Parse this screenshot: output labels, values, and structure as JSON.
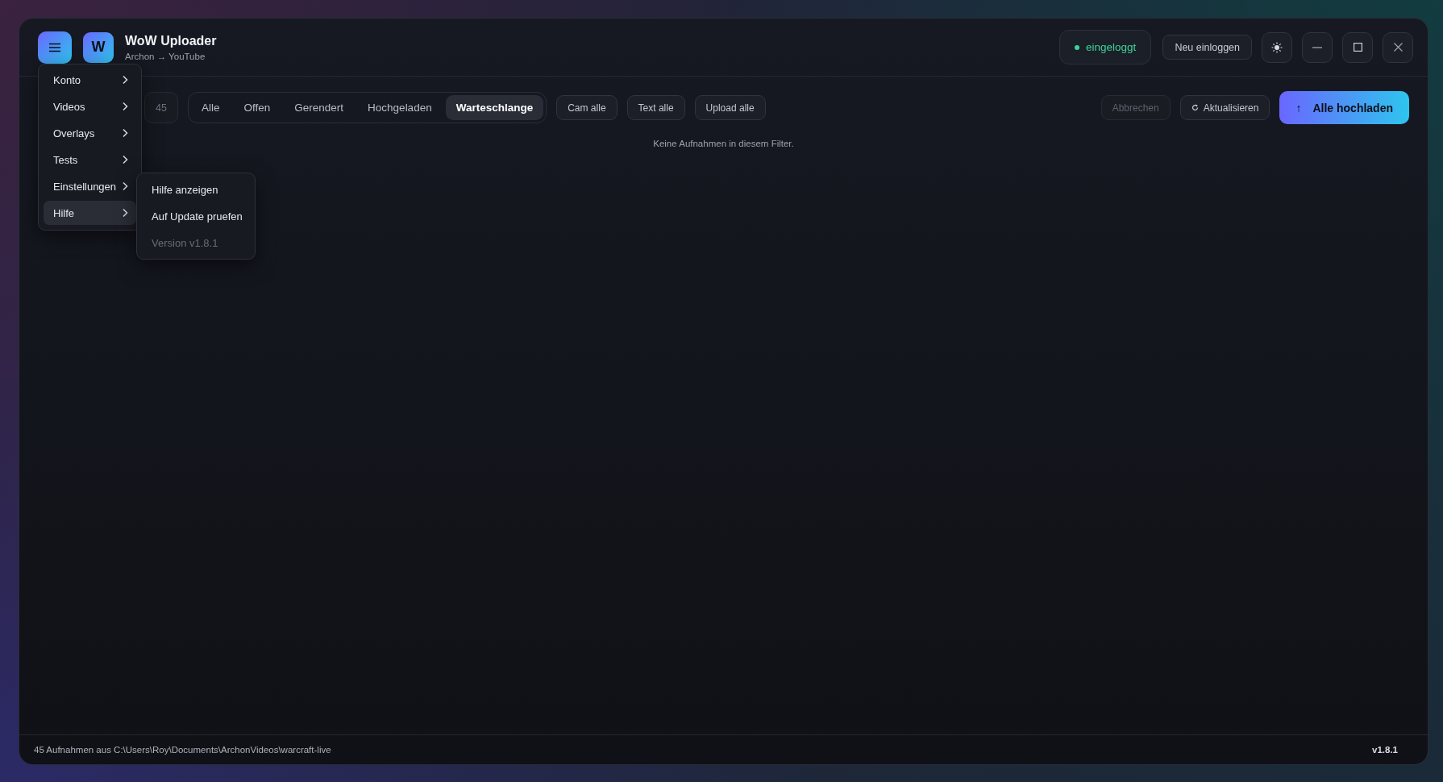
{
  "window": {
    "title": "WoW Uploader",
    "subtitle": "Archon → YouTube"
  },
  "logo": {
    "letter": "W"
  },
  "status": {
    "label": "eingeloggt",
    "logged_in": true
  },
  "header_buttons": [
    "Neu einloggen"
  ],
  "menu": {
    "items": [
      {
        "label": "Konto",
        "selected": false
      },
      {
        "label": "Videos",
        "selected": false
      },
      {
        "label": "Overlays",
        "selected": false
      },
      {
        "label": "Tests",
        "selected": false
      },
      {
        "label": "Einstellungen",
        "selected": false
      },
      {
        "label": "Hilfe",
        "selected": true
      }
    ],
    "submenu": [
      {
        "label": "Hilfe anzeigen",
        "disabled": false
      },
      {
        "label": "Auf Update pruefen",
        "disabled": false
      },
      {
        "label": "Version v1.8.1",
        "disabled": true
      }
    ]
  },
  "toolbar": {
    "count": "45",
    "tabs": [
      {
        "label": "Alle",
        "selected": false
      },
      {
        "label": "Offen",
        "selected": false
      },
      {
        "label": "Gerendert",
        "selected": false
      },
      {
        "label": "Hochgeladen",
        "selected": false
      },
      {
        "label": "Warteschlange",
        "selected": true
      }
    ],
    "bulk_buttons": [
      "Cam alle",
      "Text alle",
      "Upload alle"
    ],
    "cancel": {
      "label": "Abbrechen",
      "disabled": true
    },
    "refresh": {
      "label": "Aktualisieren"
    },
    "upload_all": {
      "label": "Alle hochladen",
      "icon": "↑"
    }
  },
  "empty_message": "Keine Aufnahmen in diesem Filter.",
  "status_bar": {
    "text": "45 Aufnahmen aus C:\\Users\\Roy\\Documents\\ArchonVideos\\warcraft-live",
    "version": "v1.8.1"
  }
}
